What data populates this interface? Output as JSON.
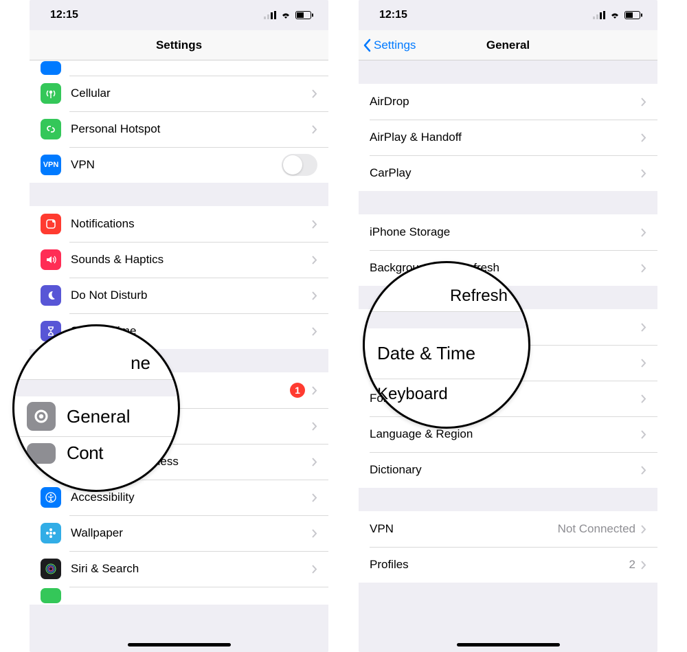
{
  "status": {
    "time": "12:15"
  },
  "left": {
    "title": "Settings",
    "rows_g1_partial": {
      "label": ""
    },
    "rows_g1": [
      {
        "label": "Cellular",
        "icon": "antenna",
        "color": "c-green"
      },
      {
        "label": "Personal Hotspot",
        "icon": "link",
        "color": "c-green"
      },
      {
        "label": "VPN",
        "icon": "vpn-text",
        "color": "c-blue",
        "toggle": true
      }
    ],
    "rows_g2": [
      {
        "label": "Notifications",
        "icon": "bell",
        "color": "c-red"
      },
      {
        "label": "Sounds & Haptics",
        "icon": "speaker",
        "color": "c-redspk"
      },
      {
        "label": "Do Not Disturb",
        "icon": "moon",
        "color": "c-purple"
      },
      {
        "label": "Screen Time",
        "icon": "hourglass",
        "color": "c-purple"
      }
    ],
    "rows_g3": [
      {
        "label": "General",
        "icon": "gear",
        "color": "c-gray",
        "badge": "1"
      },
      {
        "label": "Control Center",
        "icon": "switches",
        "color": "c-gray"
      },
      {
        "label": "Display & Brightness",
        "icon": "aa",
        "color": "c-blue"
      },
      {
        "label": "Accessibility",
        "icon": "person",
        "color": "c-blue"
      },
      {
        "label": "Wallpaper",
        "icon": "flower",
        "color": "c-teal"
      },
      {
        "label": "Siri & Search",
        "icon": "siri",
        "color": "c-siri"
      }
    ],
    "magnifier": {
      "primary": {
        "label": "General",
        "icon": "gear",
        "color": "c-gray",
        "badge": "1"
      },
      "secondary": {
        "label": "Control Center"
      },
      "above_fragment": "ne"
    }
  },
  "right": {
    "title": "General",
    "back": "Settings",
    "rows_g1": [
      {
        "label": "AirDrop"
      },
      {
        "label": "AirPlay & Handoff"
      },
      {
        "label": "CarPlay"
      }
    ],
    "rows_g2": [
      {
        "label": "iPhone Storage"
      },
      {
        "label": "Background App Refresh"
      }
    ],
    "rows_g3": [
      {
        "label": "Date & Time"
      },
      {
        "label": "Keyboard"
      },
      {
        "label": "Fonts"
      },
      {
        "label": "Language & Region"
      },
      {
        "label": "Dictionary"
      }
    ],
    "rows_g4": [
      {
        "label": "VPN",
        "detail": "Not Connected"
      },
      {
        "label": "Profiles",
        "detail": "2"
      }
    ],
    "magnifier": {
      "primary": {
        "label": "Date & Time"
      },
      "below_fragment": "Keyboard",
      "above_fragment": "Refresh"
    }
  }
}
